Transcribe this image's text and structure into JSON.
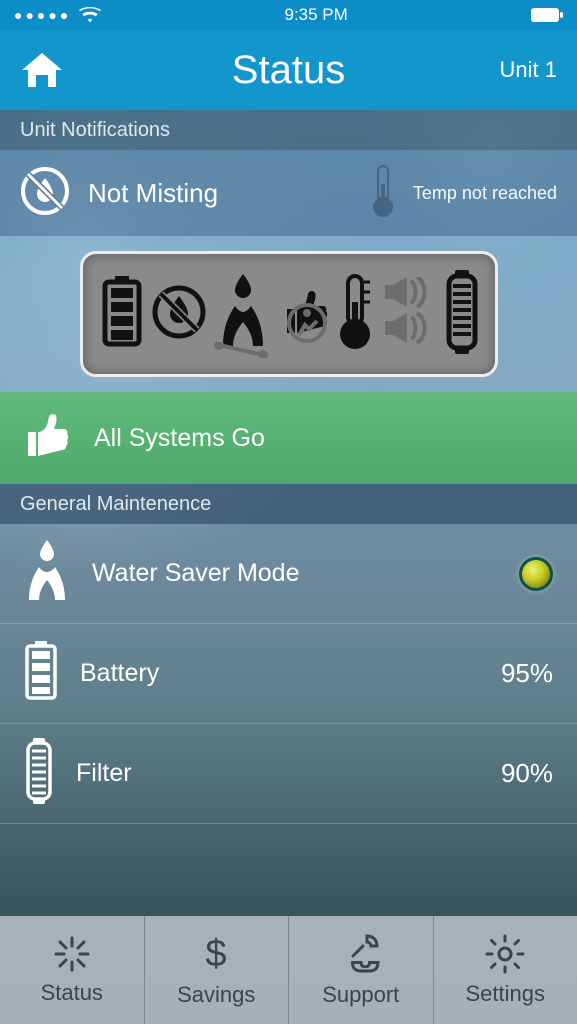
{
  "statusbar": {
    "signal_dots": "●●●●●",
    "time": "9:35 PM"
  },
  "header": {
    "title": "Status",
    "unit_label": "Unit 1"
  },
  "sections": {
    "notifications": "Unit Notifications",
    "maintenance": "General Maintenence"
  },
  "notifications": {
    "misting_label": "Not Misting",
    "temp_label": "Temp not reached"
  },
  "systems": {
    "label": "All Systems Go"
  },
  "maintenance": {
    "water_saver": {
      "label": "Water Saver Mode"
    },
    "battery": {
      "label": "Battery",
      "value": "95%"
    },
    "filter": {
      "label": "Filter",
      "value": "90%"
    }
  },
  "tabs": {
    "status": "Status",
    "savings": "Savings",
    "support": "Support",
    "settings": "Settings"
  }
}
